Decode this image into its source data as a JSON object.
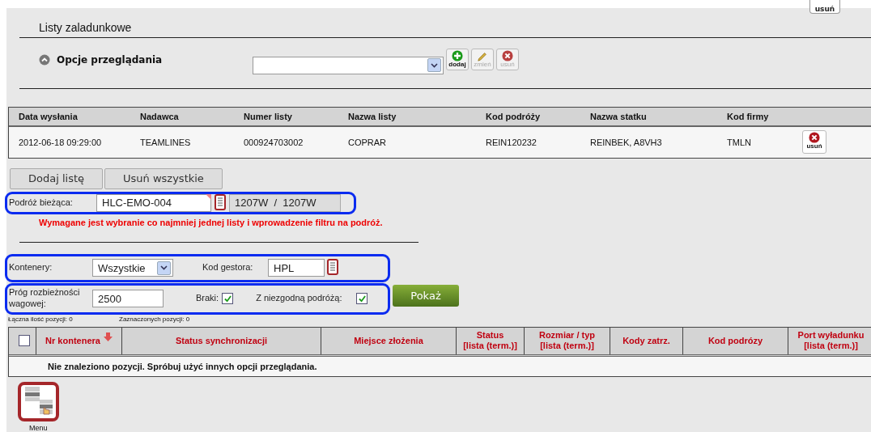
{
  "top_bar": {
    "delete_label": "usuń"
  },
  "section": {
    "title": "Listy zaladunkowe"
  },
  "options": {
    "label": "Opcje przeglądania",
    "expanded": true,
    "actions": [
      {
        "kind": "add",
        "label": "dodaj",
        "disabled": false
      },
      {
        "kind": "edit",
        "label": "zmień",
        "disabled": true
      },
      {
        "kind": "delete",
        "label": "usuń",
        "disabled": true
      }
    ]
  },
  "lists_table": {
    "columns": [
      "Data wysłania",
      "Nadawca",
      "Numer listy",
      "Nazwa listy",
      "Kod podróży",
      "Nazwa statku",
      "Kod firmy"
    ],
    "rows": [
      {
        "cells": [
          "2012-06-18 09:29:00",
          "TEAMLINES",
          "000924703002",
          "COPRAR",
          "REIN120232",
          "REINBEK, A8VH3",
          "TMLN"
        ],
        "delete_label": "usuń"
      }
    ]
  },
  "list_buttons": [
    "Dodaj listę",
    "Usuń wszystkie"
  ],
  "voyage": {
    "label": "Podróż bieżąca:",
    "value": "HLC-EMO-004",
    "readonly_value": "1207W  /  1207W"
  },
  "error": "Wymagane jest wybranie co najmniej jednej listy i wprowadzenie filtru na podróż.",
  "filters": {
    "containers_label": "Kontenery:",
    "containers_value": "Wszystkie",
    "operator_label": "Kod gestora:",
    "operator_value": "HPL",
    "threshold_label": "Próg rozbieżności wagowej:",
    "threshold_value": "2500",
    "checks": [
      {
        "label": "Braki:",
        "checked": true
      },
      {
        "label": "Z niezgodną podróżą:",
        "checked": true
      }
    ],
    "show_button": "Pokaż"
  },
  "counts": [
    "Łączna ilość pozycji: 0",
    "Zaznaczonych pozycji: 0"
  ],
  "containers_table": {
    "select_all_checked": false,
    "columns": [
      {
        "label": "Nr kontenera",
        "sorted": true
      },
      {
        "label": "Status synchronizacji",
        "sorted": false
      },
      {
        "label": "Miejsce złożenia",
        "sorted": false
      },
      {
        "label": "Status\n[lista (term.)]",
        "sorted": false
      },
      {
        "label": "Rozmiar / typ\n[lista (term.)]",
        "sorted": false
      },
      {
        "label": "Kody zatrz.",
        "sorted": false
      },
      {
        "label": "Kod podrózy",
        "sorted": false
      },
      {
        "label": "Port wyładunku\n[lista (term.)]",
        "sorted": false
      }
    ],
    "empty_message": "Nie znaleziono pozycji. Spróbuj użyć innych opcji przeglądania."
  },
  "menu": {
    "label": "Menu"
  }
}
